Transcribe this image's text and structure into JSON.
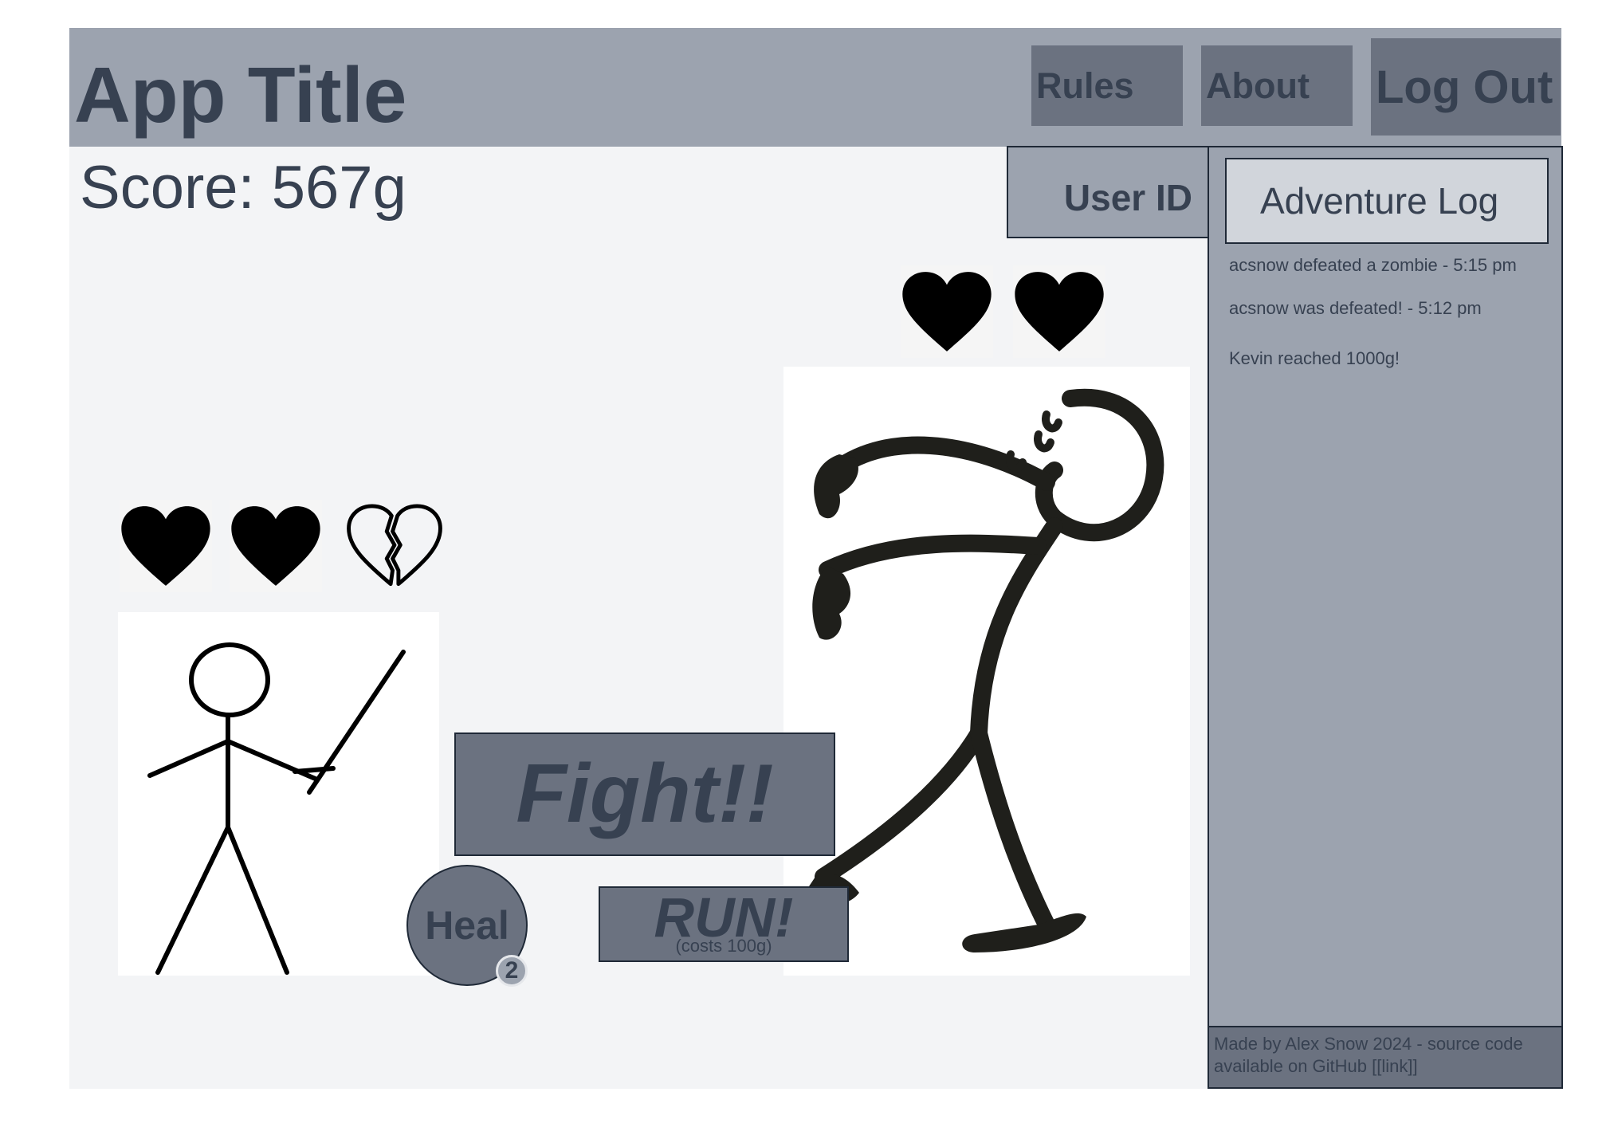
{
  "header": {
    "app_title": "App Title",
    "nav": {
      "rules": "Rules",
      "about": "About",
      "log_out": "Log Out"
    }
  },
  "score": {
    "label": "Score: 567g"
  },
  "user": {
    "id_label": "User ID"
  },
  "adventure_log": {
    "title": "Adventure Log",
    "entries": [
      "acsnow defeated a zombie - 5:15 pm",
      "acsnow was defeated! - 5:12 pm",
      "Kevin reached 1000g!"
    ]
  },
  "player": {
    "hearts": [
      "full-heart-icon",
      "full-heart-icon",
      "broken-heart-icon"
    ],
    "hearts_remaining": 2,
    "hearts_total": 3
  },
  "enemy": {
    "hearts": [
      "full-heart-icon",
      "full-heart-icon"
    ],
    "hearts_remaining": 2
  },
  "actions": {
    "fight": "Fight!!",
    "run": "RUN!",
    "run_cost": "(costs 100g)",
    "heal": "Heal",
    "heal_count": "2"
  },
  "footer": {
    "text": "Made by Alex Snow 2024 - source code available on GitHub [[link]]"
  },
  "colors": {
    "header_bg": "#9ca3af",
    "button_bg": "#6b7280",
    "page_bg": "#f3f4f6",
    "text": "#374151",
    "log_title_bg": "#d1d5db"
  }
}
